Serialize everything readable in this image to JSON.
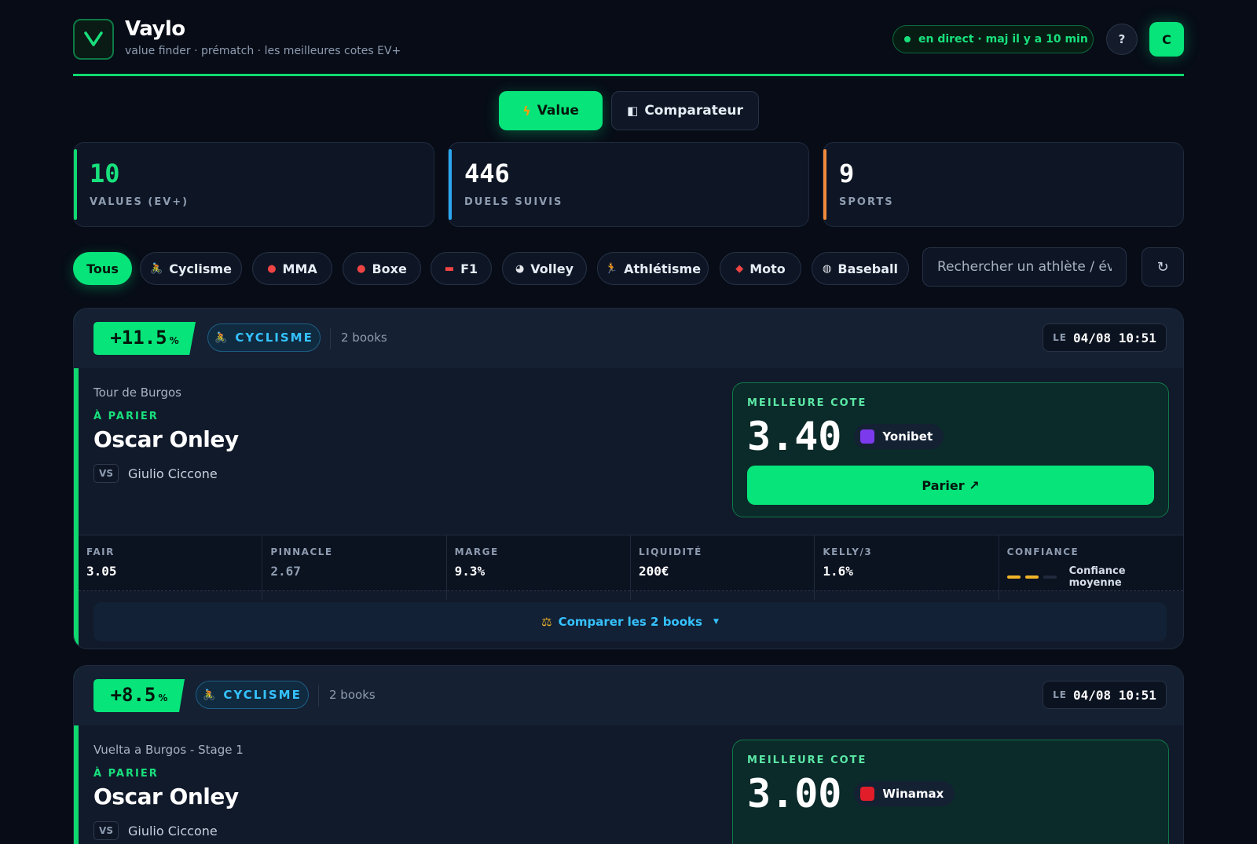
{
  "header": {
    "logo_letter": "V",
    "title": "Vaylo",
    "tagline": "value finder · prématch · les meilleures cotes EV+",
    "live_status": "en direct · maj il y a 10 min",
    "help_label": "?",
    "user_initial": "C"
  },
  "mode_tabs": [
    {
      "label": "Value",
      "icon": "lightning-icon",
      "active": true
    },
    {
      "label": "Comparateur",
      "icon": "compare-icon",
      "active": false
    }
  ],
  "stats": [
    {
      "value": "10",
      "label": "VALUES (EV+)"
    },
    {
      "value": "446",
      "label": "DUELS SUIVIS"
    },
    {
      "value": "9",
      "label": "SPORTS"
    }
  ],
  "filters": {
    "chips": [
      {
        "label": "Tous",
        "icon": "",
        "active": true
      },
      {
        "label": "Cyclisme",
        "icon": "cyclist-icon"
      },
      {
        "label": "MMA",
        "icon": "boxing-glove-icon"
      },
      {
        "label": "Boxe",
        "icon": "boxing-glove-icon"
      },
      {
        "label": "F1",
        "icon": "race-car-icon"
      },
      {
        "label": "Volley",
        "icon": "volleyball-icon"
      },
      {
        "label": "Athlétisme",
        "icon": "runner-icon"
      },
      {
        "label": "Moto",
        "icon": "motorcycle-icon"
      },
      {
        "label": "Baseball",
        "icon": "baseball-icon"
      }
    ],
    "search_placeholder": "Rechercher un athlète / événe",
    "refresh_icon": "↻"
  },
  "cards": [
    {
      "ev_value": "+11.5",
      "ev_unit": "%",
      "sport": "CYCLISME",
      "books": "2 books",
      "date_prefix": "LE",
      "date": "04/08 10:51",
      "event": "Tour de Burgos",
      "to_bet_label": "À PARIER",
      "athlete": "Oscar Onley",
      "vs_label": "VS",
      "opponent": "Giulio Ciccone",
      "best_label": "MEILLEURE COTE",
      "best_odds": "3.40",
      "bookmaker": "Yonibet",
      "bookmaker_color": "#7c3aed",
      "bet_label": "Parier ↗",
      "metrics": [
        {
          "label": "FAIR",
          "value": "3.05"
        },
        {
          "label": "PINNACLE",
          "value": "2.67"
        },
        {
          "label": "MARGE",
          "value": "9.3%"
        },
        {
          "label": "LIQUIDITÉ",
          "value": "200€"
        },
        {
          "label": "KELLY/3",
          "value": "1.6%"
        },
        {
          "label": "CONFIANCE",
          "value": "Confiance moyenne"
        }
      ],
      "confidence_level": 2,
      "confidence_max": 3,
      "confidence_color": "#f0b429",
      "compare_label": "Comparer les 2 books"
    },
    {
      "ev_value": "+8.5",
      "ev_unit": "%",
      "sport": "CYCLISME",
      "books": "2 books",
      "date_prefix": "LE",
      "date": "04/08 10:51",
      "event": "Vuelta a Burgos - Stage 1",
      "to_bet_label": "À PARIER",
      "athlete": "Oscar Onley",
      "vs_label": "VS",
      "opponent": "Giulio Ciccone",
      "best_label": "MEILLEURE COTE",
      "best_odds": "3.00",
      "bookmaker": "Winamax",
      "bookmaker_color": "#e11d2a"
    }
  ],
  "colors": {
    "accent": "#06e47a",
    "background": "#070c17",
    "card": "#111a2b",
    "sport_blue": "#35c2ff"
  }
}
